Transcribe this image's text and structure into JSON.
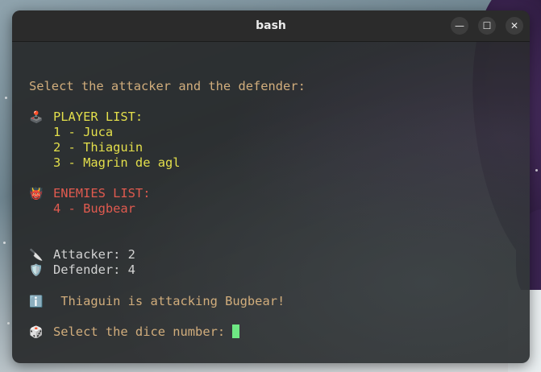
{
  "window": {
    "title": "bash"
  },
  "terminal": {
    "prompt": "Select the attacker and the defender:",
    "player_list": {
      "icon": "🕹️",
      "icon_name": "joystick-icon",
      "header": "PLAYER LIST:",
      "items": [
        "1 - Juca",
        "2 - Thiaguin",
        "3 - Magrin de agl"
      ]
    },
    "enemies_list": {
      "icon": "👹",
      "icon_name": "ogre-icon",
      "header": "ENEMIES LIST:",
      "items": [
        "4 - Bugbear"
      ]
    },
    "attacker": {
      "icon": "🔪",
      "icon_name": "knife-icon",
      "text": "Attacker: 2"
    },
    "defender": {
      "icon": "🛡️",
      "icon_name": "shield-icon",
      "text": "Defender: 4"
    },
    "info": {
      "icon": "ℹ️",
      "icon_name": "info-icon",
      "text": " Thiaguin is attacking Bugbear!"
    },
    "dice": {
      "icon": "🎲",
      "icon_name": "dice-icon",
      "text": "Select the dice number: "
    }
  },
  "colors": {
    "prompt_text": "#d1ad7c",
    "player_text": "#e3df4b",
    "enemy_text": "#e05a4f",
    "plain_text": "#d2d2d2",
    "cursor": "#6ee883"
  }
}
